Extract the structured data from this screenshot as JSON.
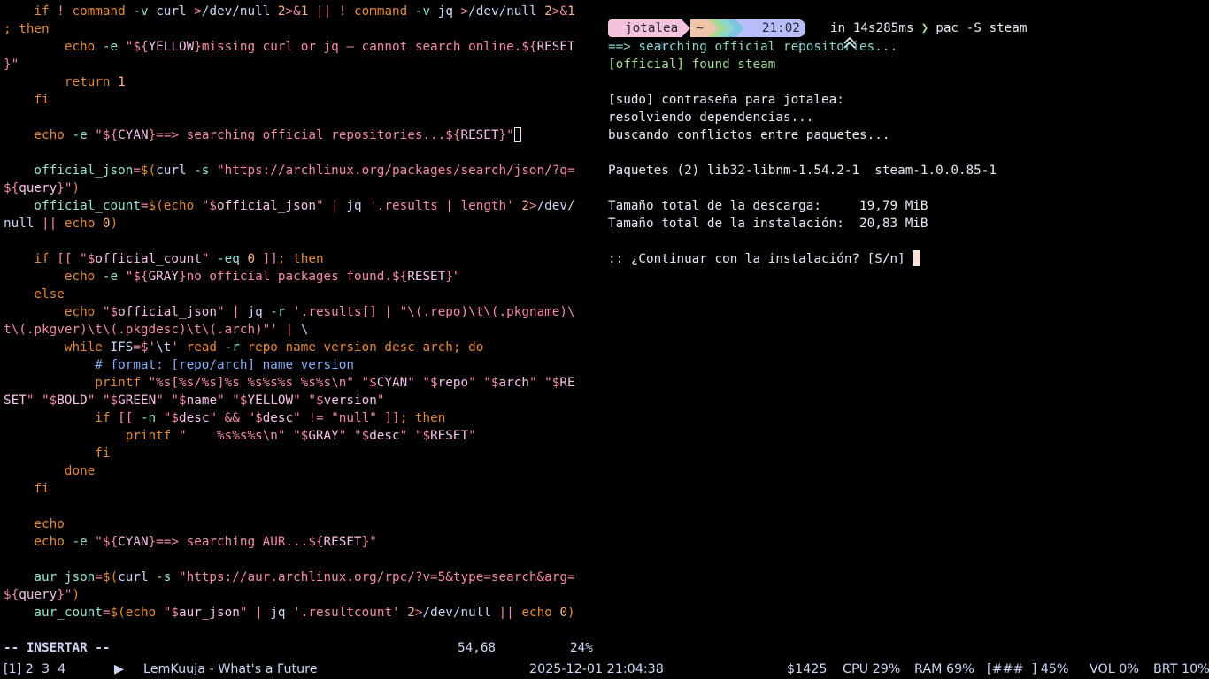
{
  "editor": {
    "lines": [
      [
        [
          "c-kw",
          "    if "
        ],
        [
          "c-op",
          "! "
        ],
        [
          "c-kw",
          "command "
        ],
        [
          "c-fn",
          "-v "
        ],
        [
          "c-def",
          "curl "
        ],
        [
          "c-op",
          ">"
        ],
        [
          "c-def",
          "/dev/null "
        ],
        [
          "c-num",
          "2"
        ],
        [
          "c-op",
          ">&"
        ],
        [
          "c-num",
          "1"
        ],
        [
          "c-op",
          " || ! "
        ],
        [
          "c-kw",
          "command "
        ],
        [
          "c-fn",
          "-v "
        ],
        [
          "c-def",
          "jq "
        ],
        [
          "c-op",
          ">"
        ],
        [
          "c-def",
          "/dev/null "
        ],
        [
          "c-num",
          "2"
        ],
        [
          "c-op",
          ">&"
        ],
        [
          "c-num",
          "1"
        ]
      ],
      [
        [
          "c-kw",
          "; then"
        ]
      ],
      [
        [
          "c-kw",
          "        echo "
        ],
        [
          "c-fn",
          "-e "
        ],
        [
          "c-str",
          "\"${"
        ],
        [
          "c-var",
          "YELLOW"
        ],
        [
          "c-str",
          "}missing curl or jq — cannot search online.${"
        ],
        [
          "c-var",
          "RESET"
        ]
      ],
      [
        [
          "c-str",
          "}\""
        ]
      ],
      [
        [
          "c-kw",
          "        return "
        ],
        [
          "c-num",
          "1"
        ]
      ],
      [
        [
          "c-kw",
          "    fi"
        ]
      ],
      [
        [
          "c-def",
          ""
        ]
      ],
      [
        [
          "c-kw",
          "    echo "
        ],
        [
          "c-fn",
          "-e "
        ],
        [
          "c-str",
          "\"${"
        ],
        [
          "c-var",
          "CYAN"
        ],
        [
          "c-str",
          "}==> searching official repositories...${"
        ],
        [
          "c-var",
          "RESET"
        ],
        [
          "c-str",
          "}\""
        ],
        [
          "cursor",
          ""
        ]
      ],
      [
        [
          "c-def",
          ""
        ]
      ],
      [
        [
          "c-fn",
          "    official_json"
        ],
        [
          "c-op",
          "="
        ],
        [
          "c-kw",
          "$("
        ],
        [
          "c-def",
          "curl "
        ],
        [
          "c-fn",
          "-s "
        ],
        [
          "c-str",
          "\"https://archlinux.org/packages/search/json/?q="
        ]
      ],
      [
        [
          "c-str",
          "${"
        ],
        [
          "c-var",
          "query"
        ],
        [
          "c-str",
          "}\""
        ],
        [
          "c-kw",
          ")"
        ]
      ],
      [
        [
          "c-fn",
          "    official_count"
        ],
        [
          "c-op",
          "="
        ],
        [
          "c-kw",
          "$(echo "
        ],
        [
          "c-str",
          "\"$"
        ],
        [
          "c-var",
          "official_json"
        ],
        [
          "c-str",
          "\""
        ],
        [
          "c-op",
          " | "
        ],
        [
          "c-def",
          "jq "
        ],
        [
          "c-str",
          "'.results | length' "
        ],
        [
          "c-num",
          "2"
        ],
        [
          "c-op",
          ">"
        ],
        [
          "c-def",
          "/dev/"
        ]
      ],
      [
        [
          "c-def",
          "null "
        ],
        [
          "c-op",
          "|| "
        ],
        [
          "c-kw",
          "echo "
        ],
        [
          "c-num",
          "0"
        ],
        [
          "c-kw",
          ")"
        ]
      ],
      [
        [
          "c-def",
          ""
        ]
      ],
      [
        [
          "c-kw",
          "    if "
        ],
        [
          "c-op",
          "[[ "
        ],
        [
          "c-str",
          "\"$"
        ],
        [
          "c-var",
          "official_count"
        ],
        [
          "c-str",
          "\" "
        ],
        [
          "c-fn",
          "-eq "
        ],
        [
          "c-num",
          "0 "
        ],
        [
          "c-op",
          "]]"
        ],
        [
          "c-kw",
          "; then"
        ]
      ],
      [
        [
          "c-kw",
          "        echo "
        ],
        [
          "c-fn",
          "-e "
        ],
        [
          "c-str",
          "\"${"
        ],
        [
          "c-var",
          "GRAY"
        ],
        [
          "c-str",
          "}no official packages found.${"
        ],
        [
          "c-var",
          "RESET"
        ],
        [
          "c-str",
          "}\""
        ]
      ],
      [
        [
          "c-kw",
          "    else"
        ]
      ],
      [
        [
          "c-kw",
          "        echo "
        ],
        [
          "c-str",
          "\"$"
        ],
        [
          "c-var",
          "official_json"
        ],
        [
          "c-str",
          "\""
        ],
        [
          "c-op",
          " | "
        ],
        [
          "c-def",
          "jq "
        ],
        [
          "c-fn",
          "-r "
        ],
        [
          "c-str",
          "'.results[] | \"\\(.repo)\\t\\(.pkgname)\\"
        ]
      ],
      [
        [
          "c-str",
          "t\\(.pkgver)\\t\\(.pkgdesc)\\t\\(.arch)\"'"
        ],
        [
          "c-op",
          " | "
        ],
        [
          "c-def",
          "\\"
        ]
      ],
      [
        [
          "c-kw",
          "        while "
        ],
        [
          "c-def",
          "IFS"
        ],
        [
          "c-op",
          "="
        ],
        [
          "c-str",
          "$'"
        ],
        [
          "c-def",
          "\\t"
        ],
        [
          "c-str",
          "' "
        ],
        [
          "c-kw",
          "read "
        ],
        [
          "c-fn",
          "-r "
        ],
        [
          "c-kw",
          "repo name version desc arch; do"
        ]
      ],
      [
        [
          "c-com",
          "            # format: [repo/arch] name version"
        ]
      ],
      [
        [
          "c-kw",
          "            printf "
        ],
        [
          "c-str",
          "\"%s[%s/%s]%s %s%s%s %s%s\\n\" \"$"
        ],
        [
          "c-var",
          "CYAN"
        ],
        [
          "c-str",
          "\" \"$"
        ],
        [
          "c-var",
          "repo"
        ],
        [
          "c-str",
          "\" \"$"
        ],
        [
          "c-var",
          "arch"
        ],
        [
          "c-str",
          "\" \"$"
        ],
        [
          "c-var",
          "RE"
        ]
      ],
      [
        [
          "c-var",
          "SET"
        ],
        [
          "c-str",
          "\" \"$"
        ],
        [
          "c-var",
          "BOLD"
        ],
        [
          "c-str",
          "\" \"$"
        ],
        [
          "c-var",
          "GREEN"
        ],
        [
          "c-str",
          "\" \"$"
        ],
        [
          "c-var",
          "name"
        ],
        [
          "c-str",
          "\" \"$"
        ],
        [
          "c-var",
          "YELLOW"
        ],
        [
          "c-str",
          "\" \"$"
        ],
        [
          "c-var",
          "version"
        ],
        [
          "c-str",
          "\""
        ]
      ],
      [
        [
          "c-kw",
          "            if "
        ],
        [
          "c-op",
          "[[ "
        ],
        [
          "c-fn",
          "-n "
        ],
        [
          "c-str",
          "\"$"
        ],
        [
          "c-var",
          "desc"
        ],
        [
          "c-str",
          "\" "
        ],
        [
          "c-op",
          "&& "
        ],
        [
          "c-str",
          "\"$"
        ],
        [
          "c-var",
          "desc"
        ],
        [
          "c-str",
          "\" "
        ],
        [
          "c-op",
          "!= "
        ],
        [
          "c-str",
          "\"null\" "
        ],
        [
          "c-op",
          "]]"
        ],
        [
          "c-kw",
          "; then"
        ]
      ],
      [
        [
          "c-kw",
          "                printf "
        ],
        [
          "c-str",
          "\"    %s%s%s\\n\" \"$"
        ],
        [
          "c-var",
          "GRAY"
        ],
        [
          "c-str",
          "\" \"$"
        ],
        [
          "c-var",
          "desc"
        ],
        [
          "c-str",
          "\" \"$"
        ],
        [
          "c-var",
          "RESET"
        ],
        [
          "c-str",
          "\""
        ]
      ],
      [
        [
          "c-kw",
          "            fi"
        ]
      ],
      [
        [
          "c-kw",
          "        done"
        ]
      ],
      [
        [
          "c-kw",
          "    fi"
        ]
      ],
      [
        [
          "c-def",
          ""
        ]
      ],
      [
        [
          "c-kw",
          "    echo"
        ]
      ],
      [
        [
          "c-kw",
          "    echo "
        ],
        [
          "c-fn",
          "-e "
        ],
        [
          "c-str",
          "\"${"
        ],
        [
          "c-var",
          "CYAN"
        ],
        [
          "c-str",
          "}==> searching AUR...${"
        ],
        [
          "c-var",
          "RESET"
        ],
        [
          "c-str",
          "}\""
        ]
      ],
      [
        [
          "c-def",
          ""
        ]
      ],
      [
        [
          "c-fn",
          "    aur_json"
        ],
        [
          "c-op",
          "="
        ],
        [
          "c-kw",
          "$("
        ],
        [
          "c-def",
          "curl "
        ],
        [
          "c-fn",
          "-s "
        ],
        [
          "c-str",
          "\"https://aur.archlinux.org/rpc/?v=5&type=search&arg="
        ]
      ],
      [
        [
          "c-str",
          "${"
        ],
        [
          "c-var",
          "query"
        ],
        [
          "c-str",
          "}\""
        ],
        [
          "c-kw",
          ")"
        ]
      ],
      [
        [
          "c-fn",
          "    aur_count"
        ],
        [
          "c-op",
          "="
        ],
        [
          "c-kw",
          "$(echo "
        ],
        [
          "c-str",
          "\"$"
        ],
        [
          "c-var",
          "aur_json"
        ],
        [
          "c-str",
          "\""
        ],
        [
          "c-op",
          " | "
        ],
        [
          "c-def",
          "jq "
        ],
        [
          "c-str",
          "'.resultcount' "
        ],
        [
          "c-num",
          "2"
        ],
        [
          "c-op",
          ">"
        ],
        [
          "c-def",
          "/dev/null "
        ],
        [
          "c-op",
          "|| "
        ],
        [
          "c-kw",
          "echo "
        ],
        [
          "c-num",
          "0"
        ],
        [
          "c-kw",
          ")"
        ]
      ]
    ],
    "mode": "-- INSERTAR --",
    "cursor_position": "54,68",
    "scroll_percent": "24%"
  },
  "prompt": {
    "user": "jotalea",
    "dir": "~",
    "time": "21:02",
    "duration": "in 14s285ms",
    "arrow": "❯",
    "command": "pac -S steam"
  },
  "terminal": {
    "lines": [
      [
        [
          "c-cyan",
          "==> searching official repositories..."
        ]
      ],
      [
        [
          "c-green",
          "[official] found steam"
        ]
      ],
      [
        [
          "c-def",
          ""
        ]
      ],
      [
        [
          "c-white",
          "[sudo] contraseña para jotalea:"
        ]
      ],
      [
        [
          "c-white",
          "resolviendo dependencias..."
        ]
      ],
      [
        [
          "c-white",
          "buscando conflictos entre paquetes..."
        ]
      ],
      [
        [
          "c-def",
          ""
        ]
      ],
      [
        [
          "c-white",
          "Paquetes (2) lib32-libnm-1.54.2-1  steam-1.0.0.85-1"
        ]
      ],
      [
        [
          "c-def",
          ""
        ]
      ],
      [
        [
          "c-white",
          "Tamaño total de la descarga:     19,79 MiB"
        ]
      ],
      [
        [
          "c-white",
          "Tamaño total de la instalación:  20,83 MiB"
        ]
      ],
      [
        [
          "c-def",
          ""
        ]
      ],
      [
        [
          "c-white",
          ":: ¿Continuar con la instalación? [S/n] "
        ],
        [
          "cursor-block",
          ""
        ]
      ]
    ]
  },
  "bar": {
    "workspaces": "[1] 2  3  4",
    "play_icon": "▶",
    "now_playing": "LemKuuja - What's a Future",
    "datetime": "2025-12-01 21:04:38",
    "money": "$1425",
    "cpu": "CPU 29%",
    "ram": "RAM 69%",
    "battery": "[###  ] 45%",
    "volume": "VOL 0%",
    "brightness": "BRT 10%"
  },
  "colors": {
    "background": "#000000",
    "keyword": "#e28a3b",
    "string": "#f38ba8",
    "comment": "#8aadf4",
    "cyan": "#8bd5ca",
    "green": "#a6da95",
    "prompt_user": "#f4c2dd",
    "prompt_dir": "#f0c6a8",
    "prompt_time": "#b7bdf8"
  },
  "icons": {
    "prompt_user": "arch-logo-icon",
    "prompt_time": "git-branch-icon",
    "duration": "double-chevron-up-icon"
  }
}
